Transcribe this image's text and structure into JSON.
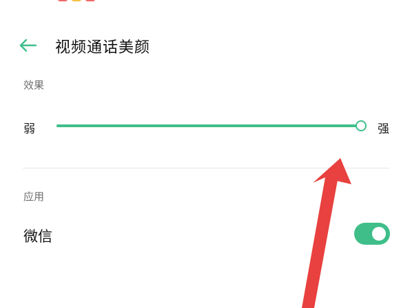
{
  "header": {
    "title": "视频通话美颜"
  },
  "effect": {
    "section_label": "效果",
    "weak_label": "弱",
    "strong_label": "强",
    "slider_value": 1.0
  },
  "apps": {
    "section_label": "应用",
    "items": [
      {
        "label": "微信",
        "enabled": true
      }
    ]
  },
  "colors": {
    "accent": "#3fbe8a",
    "annotation_arrow": "#e8413f"
  },
  "icons": [
    "back-arrow-icon"
  ]
}
